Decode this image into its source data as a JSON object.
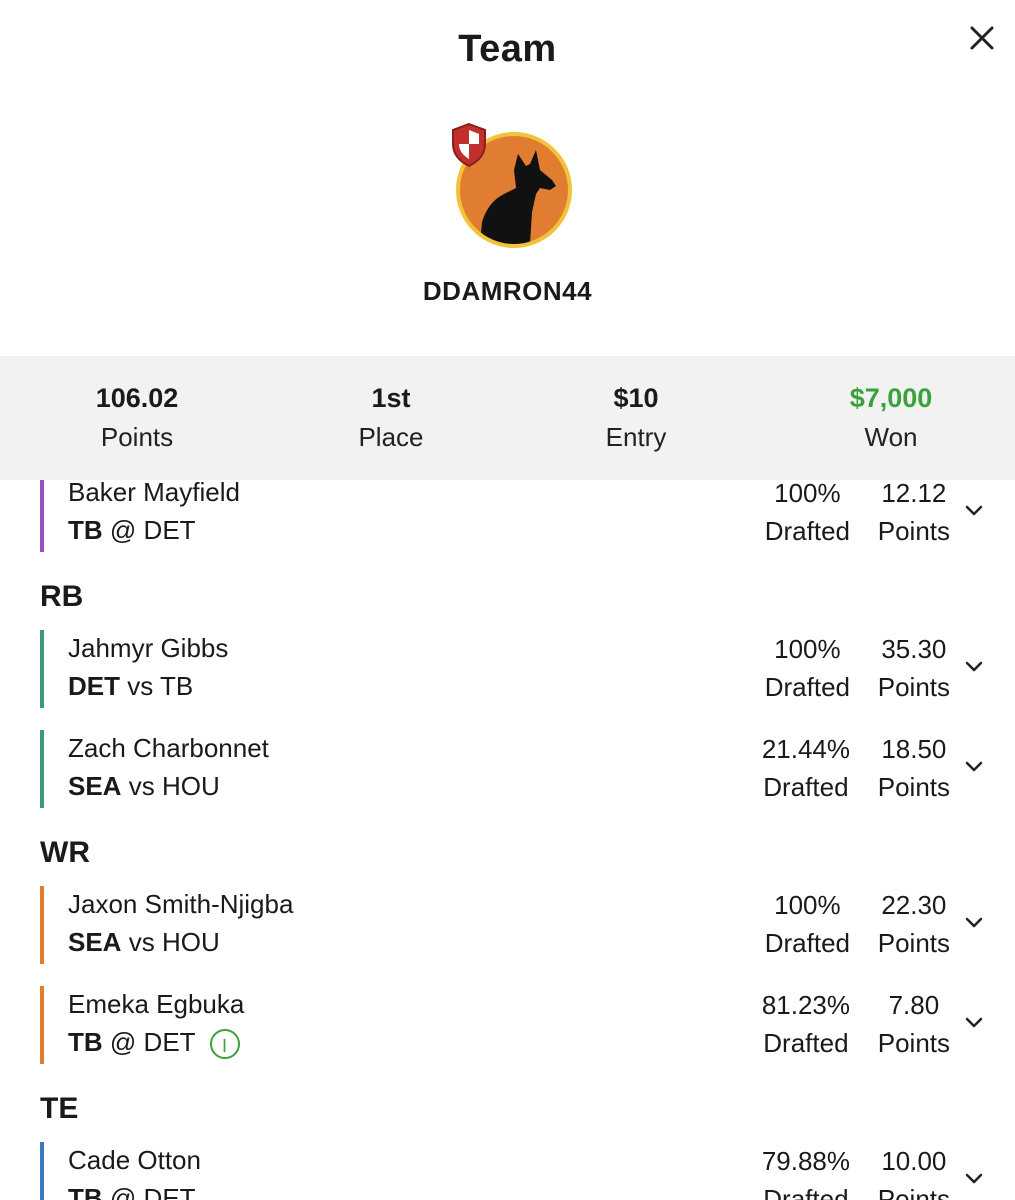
{
  "title": "Team",
  "username": "DDAMRON44",
  "stats": {
    "points": {
      "value": "106.02",
      "label": "Points"
    },
    "place": {
      "value": "1st",
      "label": "Place"
    },
    "entry": {
      "value": "$10",
      "label": "Entry"
    },
    "won": {
      "value": "$7,000",
      "label": "Won"
    }
  },
  "sections": {
    "rb": "RB",
    "wr": "WR",
    "te": "TE"
  },
  "players": [
    {
      "name": "Baker Mayfield",
      "team": "TB",
      "sep": "@",
      "opp": "DET",
      "drafted": "100%",
      "drafted_label": "Drafted",
      "points": "12.12",
      "points_label": "Points"
    },
    {
      "name": "Jahmyr Gibbs",
      "team": "DET",
      "sep": "vs",
      "opp": "TB",
      "drafted": "100%",
      "drafted_label": "Drafted",
      "points": "35.30",
      "points_label": "Points"
    },
    {
      "name": "Zach Charbonnet",
      "team": "SEA",
      "sep": "vs",
      "opp": "HOU",
      "drafted": "21.44%",
      "drafted_label": "Drafted",
      "points": "18.50",
      "points_label": "Points"
    },
    {
      "name": "Jaxon Smith-Njigba",
      "team": "SEA",
      "sep": "vs",
      "opp": "HOU",
      "drafted": "100%",
      "drafted_label": "Drafted",
      "points": "22.30",
      "points_label": "Points"
    },
    {
      "name": "Emeka Egbuka",
      "team": "TB",
      "sep": "@",
      "opp": "DET",
      "drafted": "81.23%",
      "drafted_label": "Drafted",
      "points": "7.80",
      "points_label": "Points",
      "status_badge": "I"
    },
    {
      "name": "Cade Otton",
      "team": "TB",
      "sep": "@",
      "opp": "DET",
      "drafted": "79.88%",
      "drafted_label": "Drafted",
      "points": "10.00",
      "points_label": "Points"
    }
  ],
  "colors": {
    "qb": "#9b4fc2",
    "rb": "#3a9a7e",
    "wr": "#e07d31",
    "te": "#3d78c2",
    "won": "#3aa23a",
    "avatar_bg": "#e07d31",
    "avatar_ring": "#f3c23b"
  },
  "icons": {
    "close": "close-icon",
    "chevron": "chevron-down-icon",
    "shield": "shield-badge-icon",
    "avatar": "dog-silhouette-icon"
  }
}
